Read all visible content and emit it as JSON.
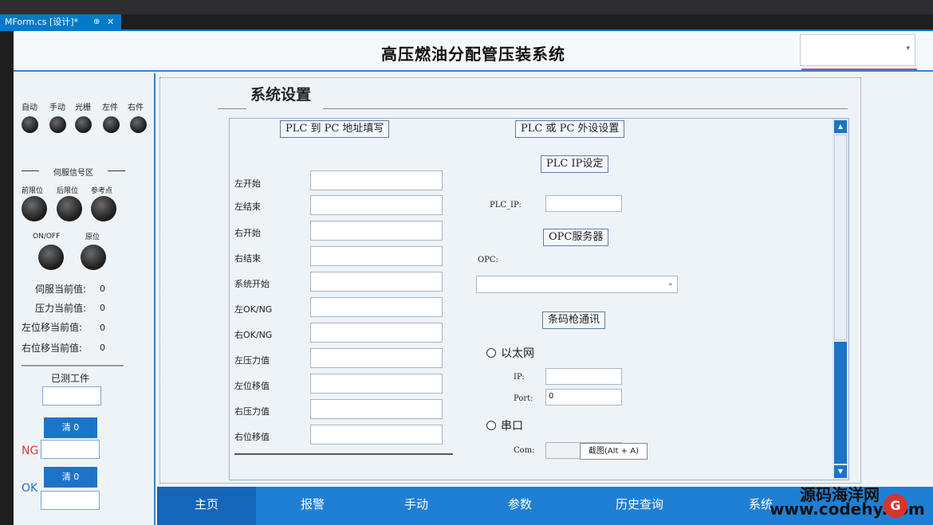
{
  "ide": {
    "doc_tab_label": "MForm.cs [设计]*",
    "pin_glyph": "⊕",
    "close_glyph": "✕"
  },
  "header": {
    "title": "高压燃油分配管压装系统",
    "combo_arrow": "▾"
  },
  "left": {
    "mode_labels": [
      "自动",
      "手动",
      "光栅",
      "左件",
      "右件"
    ],
    "servo_title": "伺服信号区",
    "servo_labels": [
      "前限位",
      "后限位",
      "参考点"
    ],
    "onoff_labels": [
      "ON/OFF",
      "原位"
    ],
    "values": [
      {
        "label": "伺服当前值:",
        "value": "0"
      },
      {
        "label": "压力当前值:",
        "value": "0"
      },
      {
        "label": "左位移当前值:",
        "value": "0"
      },
      {
        "label": "右位移当前值:",
        "value": "0"
      }
    ],
    "measured_title": "已测工件",
    "clear_ng_label": "清 0",
    "clear_ok_label": "清 0",
    "ng_label": "NG",
    "ok_label": "OK"
  },
  "settings": {
    "title": "系统设置",
    "plc_to_pc_header": "PLC 到 PC 地址填写",
    "plc_or_pc_header": "PLC 或 PC 外设设置",
    "fields": [
      "左开始",
      "左结束",
      "右开始",
      "右结束",
      "系统开始",
      "左OK/NG",
      "右OK/NG",
      "左压力值",
      "左位移值",
      "右压力值",
      "右位移值"
    ],
    "plc_ip_header": "PLC IP设定",
    "plc_ip_label": "PLC_IP:",
    "opc_header": "OPC服务器",
    "opc_label": "OPC:",
    "opc_arrow": "⌄",
    "scanner_header": "条码枪通讯",
    "ethernet_label": "以太网",
    "ip_label": "IP:",
    "port_label": "Port:",
    "port_value": "0",
    "serial_label": "串口",
    "com_label": "Com:",
    "tooltip": "截图(Alt + A)"
  },
  "nav": {
    "items": [
      "主页",
      "报警",
      "手动",
      "参数",
      "历史查询",
      "系统"
    ]
  },
  "watermark": {
    "line1": "源码海洋网",
    "line2": "www.codehy.com"
  }
}
